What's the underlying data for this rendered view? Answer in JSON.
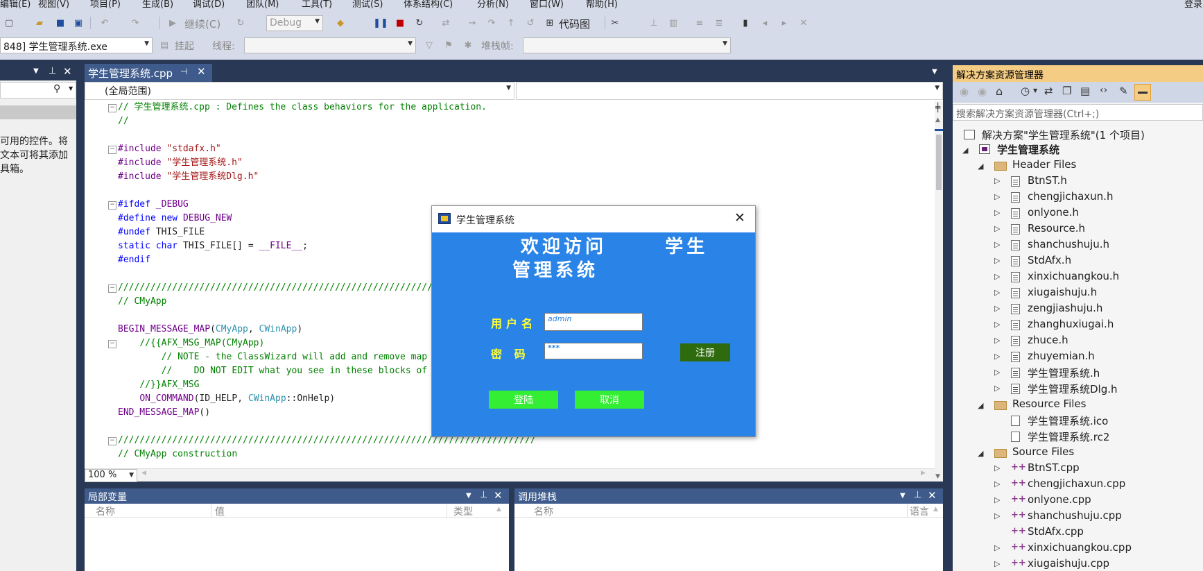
{
  "menu": [
    "编辑(E)",
    "视图(V)",
    "项目(P)",
    "生成(B)",
    "调试(D)",
    "团队(M)",
    "工具(T)",
    "测试(S)",
    "体系结构(C)",
    "分析(N)",
    "窗口(W)",
    "帮助(H)"
  ],
  "signin": "登录",
  "toolbar": {
    "continue_label": "继续(C)",
    "config_value": "Debug",
    "codemap_label": "代码图",
    "process_value": "848] 学生管理系统.exe",
    "suspend_label": "挂起",
    "thread_label": "线程:",
    "stackframe_label": "堆栈帧:"
  },
  "toolbox": {
    "hint_lines": [
      "可用的控件。将",
      "文本可将其添加",
      "具箱。"
    ]
  },
  "editor": {
    "tab_label": "学生管理系统.cpp",
    "scope_value": "(全局范围)",
    "zoom_value": "100 %"
  },
  "dialog": {
    "title": "学生管理系统",
    "welcome_line1": "欢迎访问      学生",
    "welcome_line2": "管理系统",
    "user_label": "用户名",
    "user_value": "admin",
    "pass_label": "密 码",
    "pass_value": "***",
    "register_label": "注册",
    "login_label": "登陆",
    "cancel_label": "取消",
    "bg_color": "#2a84e8",
    "green_color": "#33ee33",
    "register_color": "#2e6b0e"
  },
  "solution": {
    "title": "解决方案资源管理器",
    "search_placeholder": "搜索解决方案资源管理器(Ctrl+;)",
    "solution_label": "解决方案\"学生管理系统\"(1 个项目)",
    "project_label": "学生管理系统",
    "header_folder": "Header Files",
    "header_files": [
      "BtnST.h",
      "chengjichaxun.h",
      "onlyone.h",
      "Resource.h",
      "shanchushuju.h",
      "StdAfx.h",
      "xinxichuangkou.h",
      "xiugaishuju.h",
      "zengjiashuju.h",
      "zhanghuxiugai.h",
      "zhuce.h",
      "zhuyemian.h",
      "学生管理系统.h",
      "学生管理系统Dlg.h"
    ],
    "resource_folder": "Resource Files",
    "resource_files": [
      "学生管理系统.ico",
      "学生管理系统.rc2"
    ],
    "source_folder": "Source Files",
    "source_files": [
      "BtnST.cpp",
      "chengjichaxun.cpp",
      "onlyone.cpp",
      "shanchushuju.cpp",
      "StdAfx.cpp",
      "xinxichuangkou.cpp",
      "xiugaishuju.cpp"
    ]
  },
  "locals": {
    "title": "局部变量",
    "col_name": "名称",
    "col_value": "值",
    "col_type": "类型"
  },
  "callstack": {
    "title": "调用堆栈",
    "col_name": "名称",
    "col_lang": "语言"
  }
}
